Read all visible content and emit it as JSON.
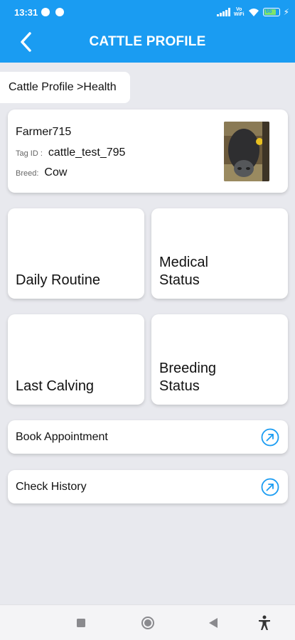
{
  "status_bar": {
    "time": "13:31",
    "network_label": "Vo\nWiFi",
    "battery_level": "66",
    "colors": {
      "bar": "#1a9cf2",
      "battery_fill": "#7fe36b"
    }
  },
  "app_bar": {
    "title": "CATTLE PROFILE",
    "back_icon": "chevron-left-icon"
  },
  "breadcrumb": "Cattle Profile >Health",
  "profile": {
    "farmer": "Farmer715",
    "tag_label": "Tag ID :",
    "tag_value": "cattle_test_795",
    "breed_label": "Breed:",
    "breed_value": "Cow"
  },
  "tiles": [
    {
      "label": "Daily Routine"
    },
    {
      "label": "Medical Status"
    },
    {
      "label": "Last Calving"
    },
    {
      "label": "Breeding Status"
    }
  ],
  "actions": [
    {
      "label": "Book Appointment",
      "icon": "arrow-up-right-circle-icon"
    },
    {
      "label": "Check History",
      "icon": "arrow-up-right-circle-icon"
    }
  ],
  "nav_bar": {
    "icons": [
      "square-icon",
      "circle-home-icon",
      "triangle-back-icon",
      "accessibility-icon"
    ]
  }
}
